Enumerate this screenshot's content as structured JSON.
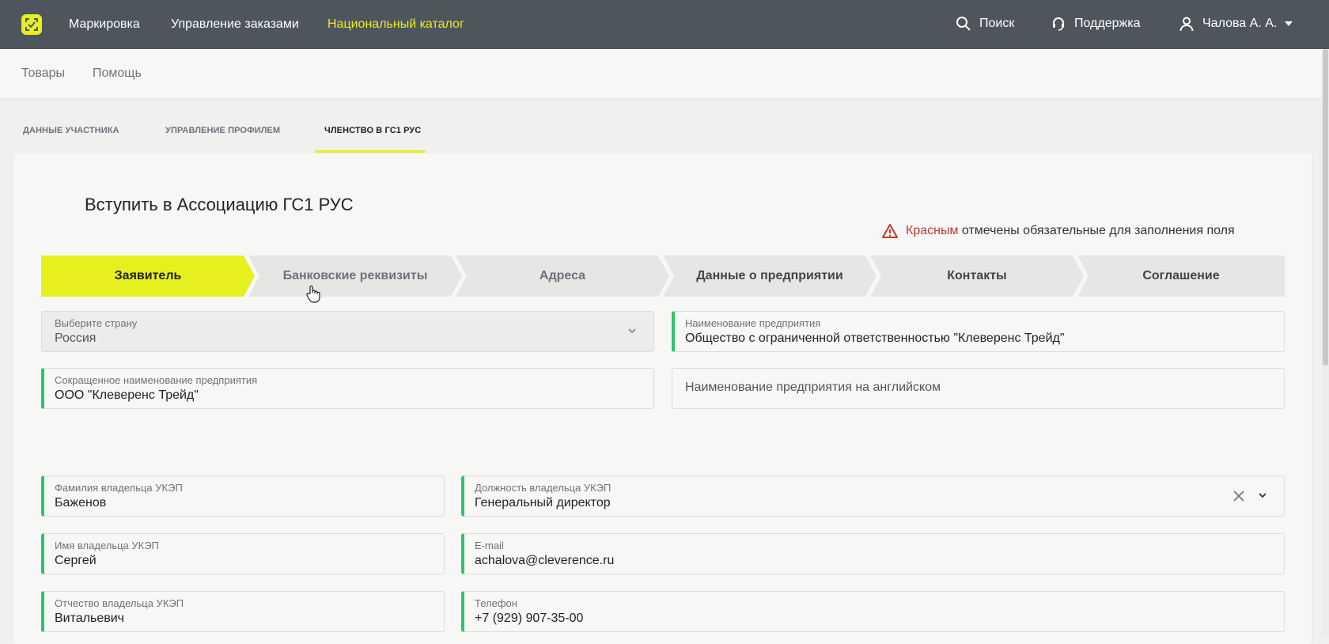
{
  "topnav": {
    "items": [
      {
        "label": "Маркировка"
      },
      {
        "label": "Управление заказами"
      },
      {
        "label": "Национальный каталог"
      }
    ],
    "search_label": "Поиск",
    "support_label": "Поддержка",
    "user_label": "Чалова А. А."
  },
  "subnav": {
    "items": [
      {
        "label": "Товары"
      },
      {
        "label": "Помощь"
      }
    ]
  },
  "tabs": [
    {
      "label": "ДАННЫЕ УЧАСТНИКА"
    },
    {
      "label": "УПРАВЛЕНИЕ ПРОФИЛЕМ"
    },
    {
      "label": "ЧЛЕНСТВО В ГС1 РУС"
    }
  ],
  "form": {
    "title": "Вступить в Ассоциацию ГС1 РУС",
    "required_note_red": "Красным",
    "required_note_rest": "отмечены обязательные для заполнения поля"
  },
  "steps": [
    {
      "label": "Заявитель"
    },
    {
      "label": "Банковские реквизиты"
    },
    {
      "label": "Адреса"
    },
    {
      "label": "Данные о предприятии"
    },
    {
      "label": "Контакты"
    },
    {
      "label": "Соглашение"
    }
  ],
  "fields": {
    "country": {
      "label": "Выберите страну",
      "value": "Россия"
    },
    "company_name": {
      "label": "Наименование предприятия",
      "value": "Общество с ограниченной ответственностью \"Клеверенс Трейд\""
    },
    "short_name": {
      "label": "Сокращенное наименование предприятия",
      "value": "ООО \"Клеверенс Трейд\""
    },
    "company_name_en": {
      "placeholder": "Наименование предприятия на английском"
    },
    "surname": {
      "label": "Фамилия владельца УКЭП",
      "value": "Баженов"
    },
    "position": {
      "label": "Должность владельца УКЭП",
      "value": "Генеральный директор"
    },
    "first_name": {
      "label": "Имя владельца УКЭП",
      "value": "Сергей"
    },
    "email": {
      "label": "E-mail",
      "value": "achalova@cleverence.ru"
    },
    "patronymic": {
      "label": "Отчество владельца УКЭП",
      "value": "Витальевич"
    },
    "phone": {
      "label": "Телефон",
      "value": "+7 (929) 907-35-00"
    }
  },
  "colors": {
    "topbar": "#4e555d",
    "accent": "#e6f01e",
    "required": "#2ec46e",
    "warning": "#c0392b"
  }
}
